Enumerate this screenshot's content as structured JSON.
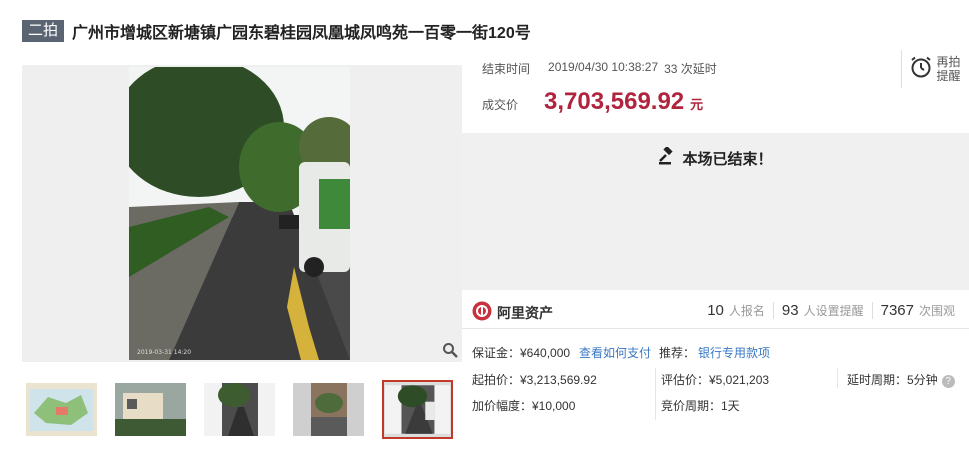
{
  "header": {
    "badge": "二拍",
    "title": "广州市增城区新塘镇广园东碧桂园凤凰城凤鸣苑一百零一街120号"
  },
  "auction": {
    "end_label": "结束时间",
    "end_time": "2019/04/30 10:38:27",
    "delays": "33 次延时",
    "remind_label": "再拍提醒",
    "price_label": "成交价",
    "price": "3,703,569.92",
    "price_unit": "元",
    "ended_text": "本场已结束！"
  },
  "photo": {
    "timestamp": "2019-03-31 14:20"
  },
  "brand": {
    "name": "阿里资产"
  },
  "stats": [
    {
      "count": "10",
      "label": "人报名"
    },
    {
      "count": "93",
      "label": "人设置提醒"
    },
    {
      "count": "7367",
      "label": "次围观"
    }
  ],
  "details": {
    "deposit": "保证金：¥640,000",
    "pay_link": "查看如何支付",
    "recommend_label": "推荐：",
    "recommend_link": "银行专用款项",
    "start_price": "起拍价：¥3,213,569.92",
    "appraisal": "评估价：¥5,021,203",
    "delay_period": "延时周期：5分钟",
    "increment": "加价幅度：¥10,000",
    "bid_period": "竞价周期：1天"
  },
  "colors": {
    "accent": "#b0243e",
    "link": "#3a78c3",
    "badge": "#5a6472"
  }
}
